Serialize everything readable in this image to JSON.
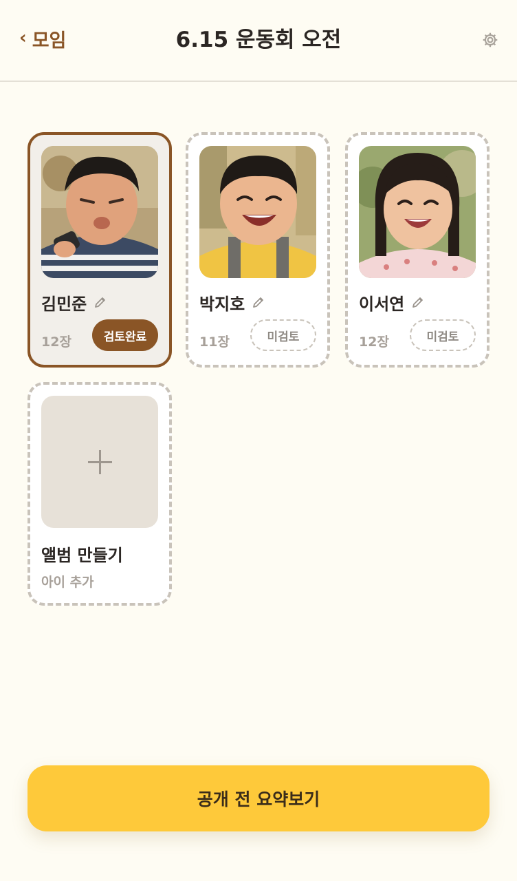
{
  "header": {
    "back_label": "모임",
    "title": "6.15 운동회 오전"
  },
  "children": [
    {
      "name": "김민준",
      "count": "12장",
      "status": "검토완료"
    },
    {
      "name": "박지호",
      "count": "11장",
      "status": "미검토"
    },
    {
      "name": "이서연",
      "count": "12장",
      "status": "미검토"
    }
  ],
  "add_album": {
    "title": "앨범 만들기",
    "subtitle": "아이 추가"
  },
  "cta": {
    "label": "공개 전 요약보기"
  },
  "icons": {
    "back": "chevron-left-icon",
    "settings": "gear-icon",
    "edit": "pencil-icon",
    "add": "plus-icon"
  },
  "colors": {
    "background": "#fefcf3",
    "accent_brown": "#8a5526",
    "cta_yellow": "#fec93a",
    "dashed_border": "#c9c3ba",
    "muted_text": "#a7a099"
  }
}
